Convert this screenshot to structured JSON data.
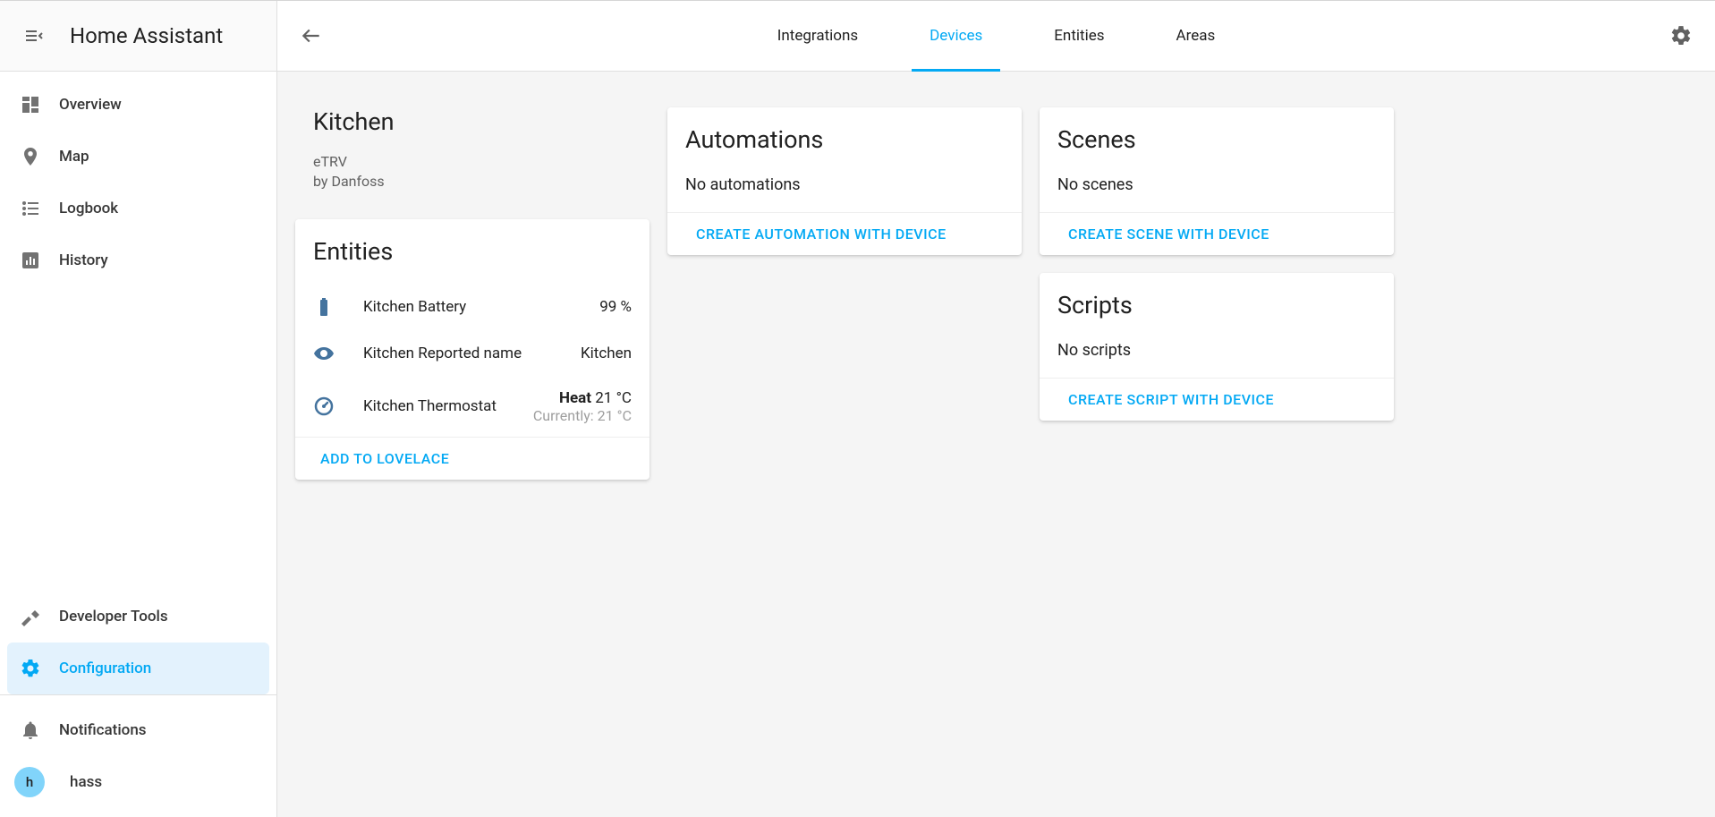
{
  "sidebar": {
    "title": "Home Assistant",
    "items": [
      {
        "label": "Overview",
        "icon": "overview"
      },
      {
        "label": "Map",
        "icon": "map"
      },
      {
        "label": "Logbook",
        "icon": "logbook"
      },
      {
        "label": "History",
        "icon": "history"
      }
    ],
    "bottom_items": [
      {
        "label": "Developer Tools",
        "icon": "hammer"
      },
      {
        "label": "Configuration",
        "icon": "gear",
        "active": true
      }
    ],
    "notifications_label": "Notifications",
    "user_label": "hass",
    "user_initial": "h"
  },
  "topbar": {
    "tabs": [
      {
        "label": "Integrations"
      },
      {
        "label": "Devices",
        "active": true
      },
      {
        "label": "Entities"
      },
      {
        "label": "Areas"
      }
    ]
  },
  "device": {
    "name": "Kitchen",
    "model": "eTRV",
    "manufacturer_line": "by Danfoss"
  },
  "entities_card": {
    "title": "Entities",
    "items": [
      {
        "icon": "battery",
        "name": "Kitchen Battery",
        "value": "99 %"
      },
      {
        "icon": "eye",
        "name": "Kitchen Reported name",
        "value": "Kitchen"
      },
      {
        "icon": "thermostat",
        "name": "Kitchen Thermostat",
        "mode": "Heat",
        "target": "21 °C",
        "current": "Currently: 21 °C"
      }
    ],
    "action": "ADD TO LOVELACE"
  },
  "automations_card": {
    "title": "Automations",
    "body": "No automations",
    "action": "CREATE AUTOMATION WITH DEVICE"
  },
  "scenes_card": {
    "title": "Scenes",
    "body": "No scenes",
    "action": "CREATE SCENE WITH DEVICE"
  },
  "scripts_card": {
    "title": "Scripts",
    "body": "No scripts",
    "action": "CREATE SCRIPT WITH DEVICE"
  }
}
